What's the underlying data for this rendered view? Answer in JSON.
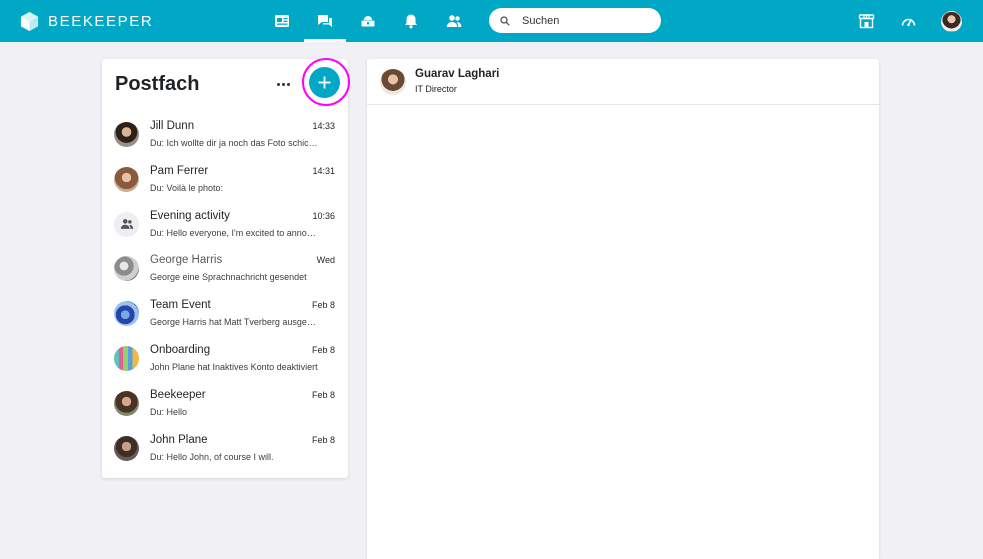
{
  "brand": {
    "name": "BEEKEEPER"
  },
  "nav": [
    {
      "id": "news",
      "icon": "newsfeed-icon",
      "active": false
    },
    {
      "id": "chats",
      "icon": "chat-icon",
      "active": true
    },
    {
      "id": "tools",
      "icon": "toolbox-icon",
      "active": false
    },
    {
      "id": "notifications",
      "icon": "bell-icon",
      "active": false
    },
    {
      "id": "people",
      "icon": "people-icon",
      "active": false
    }
  ],
  "search": {
    "placeholder": "Suchen"
  },
  "top_right_icons": [
    "store-icon",
    "dashboard-icon",
    "user-avatar"
  ],
  "inbox": {
    "title": "Postfach",
    "conversations": [
      {
        "name": "Jill Dunn",
        "time": "14:33",
        "preview": "Du: Ich wollte dir ja noch das Foto schicken",
        "avatar": "av-jill"
      },
      {
        "name": "Pam Ferrer",
        "time": "14:31",
        "preview": "Du: Voilà le photo:",
        "avatar": "av-pam"
      },
      {
        "name": "Evening activity",
        "time": "10:36",
        "preview": "Du: Hello everyone, I'm excited to announce",
        "avatar": "av-group"
      },
      {
        "name": "George Harris",
        "time": "Wed",
        "preview": "George eine Sprachnachricht gesendet",
        "avatar": "av-george"
      },
      {
        "name": "Team Event",
        "time": "Feb 8",
        "preview": "George Harris hat Matt Tverberg ausgewählt",
        "avatar": "av-team"
      },
      {
        "name": "Onboarding",
        "time": "Feb 8",
        "preview": "John Plane hat Inaktives Konto deaktiviert",
        "avatar": "av-onboarding"
      },
      {
        "name": "Beekeeper",
        "time": "Feb 8",
        "preview": "Du: Hello",
        "avatar": "av-beekeeper"
      },
      {
        "name": "John Plane",
        "time": "Feb 8",
        "preview": "Du: Hello John, of course I will.",
        "avatar": "av-john"
      }
    ]
  },
  "chat": {
    "contact_name": "Guarav Laghari",
    "contact_role": "IT Director"
  },
  "colors": {
    "brand": "#00a8c6",
    "highlight_ring": "#ff00ff",
    "background": "#f1f1f5"
  }
}
